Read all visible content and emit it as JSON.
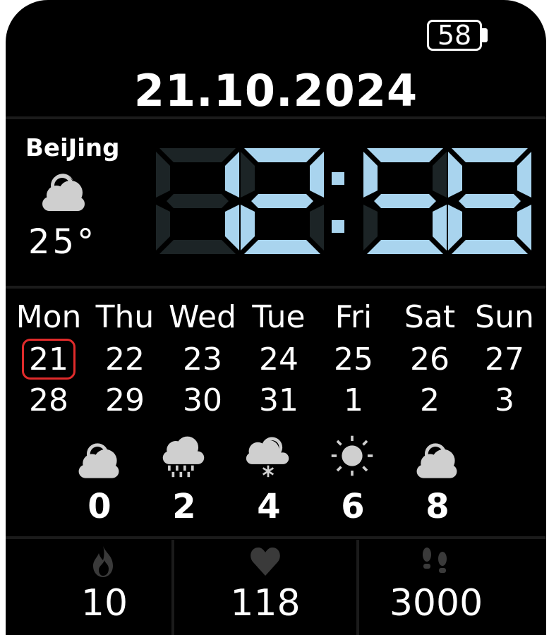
{
  "battery": {
    "level": "58"
  },
  "date": "21.10.2024",
  "weather": {
    "city": "BeiJing",
    "current_icon": "cloudy-icon",
    "temperature": "25°"
  },
  "clock": {
    "time": "12:58",
    "digit_on_color": "#a9d4ee",
    "digit_off_color": "#1c2426"
  },
  "calendar": {
    "weekdays": [
      "Mon",
      "Thu",
      "Wed",
      "Tue",
      "Fri",
      "Sat",
      "Sun"
    ],
    "week1": [
      "21",
      "22",
      "23",
      "24",
      "25",
      "26",
      "27"
    ],
    "week2": [
      "28",
      "29",
      "30",
      "31",
      "1",
      "2",
      "3"
    ],
    "today_highlight_color": "#e02b2b"
  },
  "forecast": [
    {
      "icon": "cloudy-icon",
      "value": "0"
    },
    {
      "icon": "rain-icon",
      "value": "2"
    },
    {
      "icon": "snow-icon",
      "value": "4"
    },
    {
      "icon": "sun-icon",
      "value": "6"
    },
    {
      "icon": "cloudy-icon",
      "value": "8"
    }
  ],
  "stats": {
    "calories": {
      "icon": "flame-icon",
      "value": "10"
    },
    "heart_rate": {
      "icon": "heart-icon",
      "value": "118"
    },
    "steps": {
      "icon": "footsteps-icon",
      "value": "3000"
    }
  }
}
